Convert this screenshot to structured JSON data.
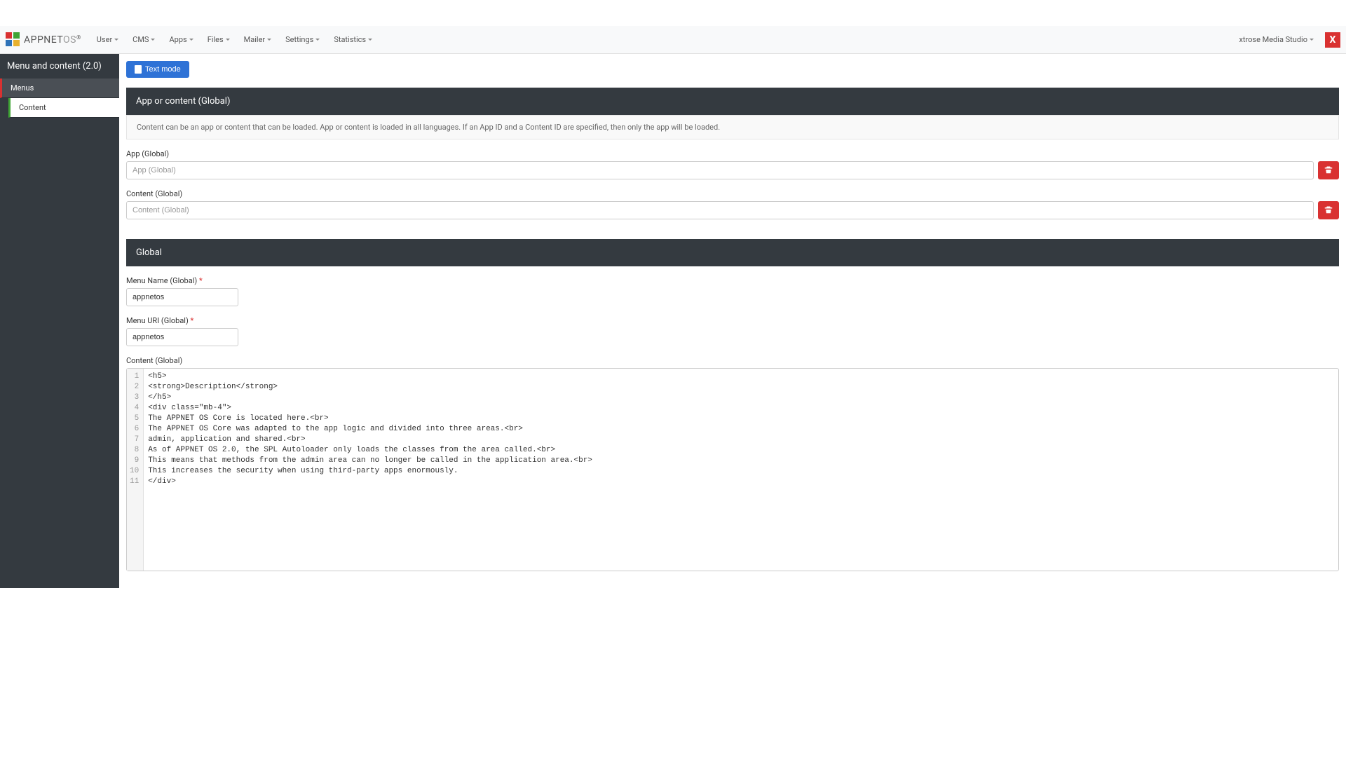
{
  "brand": {
    "name": "APPNET",
    "suffix": "OS",
    "reg": "®"
  },
  "nav": {
    "items": [
      {
        "label": "User"
      },
      {
        "label": "CMS"
      },
      {
        "label": "Apps"
      },
      {
        "label": "Files"
      },
      {
        "label": "Mailer"
      },
      {
        "label": "Settings"
      },
      {
        "label": "Statistics"
      }
    ],
    "user": "xtrose Media Studio",
    "badge": "X"
  },
  "sidebar": {
    "title": "Menu and content (2.0)",
    "items": [
      {
        "label": "Menus"
      },
      {
        "label": "Content"
      }
    ]
  },
  "toolbar": {
    "text_mode": "Text mode"
  },
  "panel1": {
    "header": "App or content (Global)",
    "info": "Content can be an app or content that can be loaded. App or content is loaded in all languages. If an App ID and a Content ID are specified, then only the app will be loaded.",
    "app_label": "App (Global)",
    "app_placeholder": "App (Global)",
    "content_label": "Content (Global)",
    "content_placeholder": "Content (Global)"
  },
  "panel2": {
    "header": "Global",
    "menu_name_label": "Menu Name (Global)",
    "menu_name_value": "appnetos",
    "menu_uri_label": "Menu URI (Global)",
    "menu_uri_value": "appnetos",
    "content_label": "Content (Global)",
    "code_lines": [
      "<h5>",
      "<strong>Description</strong>",
      "</h5>",
      "<div class=\"mb-4\">",
      "The APPNET OS Core is located here.<br>",
      "The APPNET OS Core was adapted to the app logic and divided into three areas.<br>",
      "admin, application and shared.<br>",
      "As of APPNET OS 2.0, the SPL Autoloader only loads the classes from the area called.<br>",
      "This means that methods from the admin area can no longer be called in the application area.<br>",
      "This increases the security when using third-party apps enormously.",
      "</div>"
    ]
  }
}
